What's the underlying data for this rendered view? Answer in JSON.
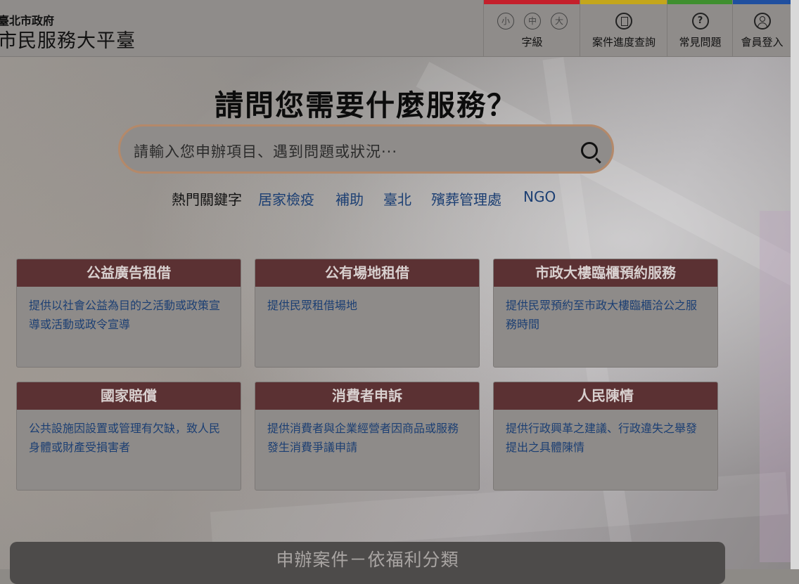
{
  "header": {
    "org": "臺北市政府",
    "site_title": "市民服務大平臺",
    "font_size": {
      "small": "小",
      "medium": "中",
      "large": "大",
      "label": "字級",
      "bar_color": "#c41f2b"
    },
    "nav": [
      {
        "label": "案件進度查詢",
        "icon": "document-icon",
        "bar_color": "#c4a61b"
      },
      {
        "label": "常見問題",
        "icon": "question-icon",
        "bar_color": "#3f8f2f"
      },
      {
        "label": "會員登入",
        "icon": "user-icon",
        "bar_color": "#1f4f9f"
      }
    ]
  },
  "hero": {
    "title": "請問您需要什麼服務？",
    "search_placeholder": "請輸入您申辦項目、遇到問題或狀況···",
    "hot_keywords_label": "熱門關鍵字",
    "hot_keywords": [
      "居家檢疫",
      "補助",
      "臺北",
      "殯葬管理處",
      "NGO"
    ]
  },
  "cards": [
    {
      "title": "公益廣告租借",
      "desc": "提供以社會公益為目的之活動或政策宣導或活動或政令宣導"
    },
    {
      "title": "公有場地租借",
      "desc": "提供民眾租借場地"
    },
    {
      "title": "市政大樓臨櫃預約服務",
      "desc": "提供民眾預約至市政大樓臨櫃洽公之服務時間"
    },
    {
      "title": "國家賠償",
      "desc": "公共設施因設置或管理有欠缺，致人民身體或財產受損害者"
    },
    {
      "title": "消費者申訴",
      "desc": "提供消費者與企業經營者因商品或服務發生消費爭議申請"
    },
    {
      "title": "人民陳情",
      "desc": "提供行政興革之建議、行政違失之舉發提出之具體陳情"
    }
  ],
  "section_bar": {
    "title": "申辦案件－依福利分類"
  }
}
